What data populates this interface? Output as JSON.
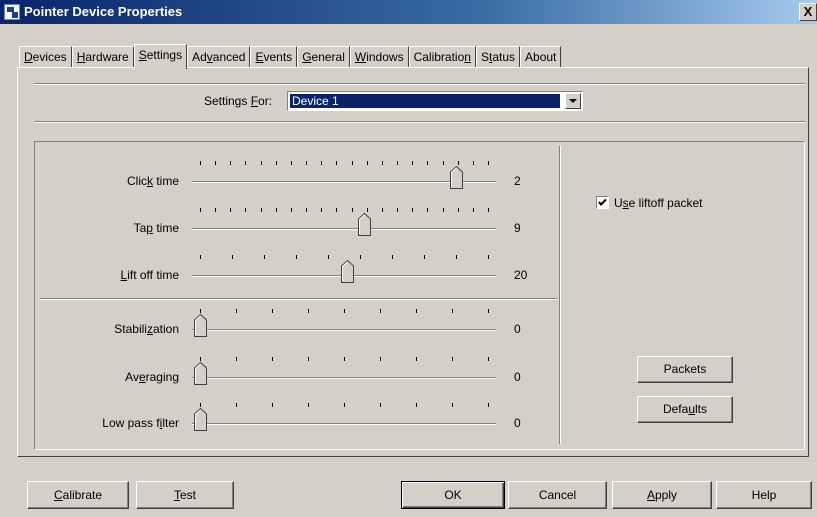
{
  "window": {
    "title": "Pointer Device Properties",
    "close_label": "X"
  },
  "tabs": [
    {
      "pre": "",
      "acc": "D",
      "post": "evices",
      "active": false
    },
    {
      "pre": "",
      "acc": "H",
      "post": "ardware",
      "active": false
    },
    {
      "pre": "",
      "acc": "S",
      "post": "ettings",
      "active": true
    },
    {
      "pre": "Ad",
      "acc": "v",
      "post": "anced",
      "active": false
    },
    {
      "pre": "",
      "acc": "E",
      "post": "vents",
      "active": false
    },
    {
      "pre": "",
      "acc": "G",
      "post": "eneral",
      "active": false
    },
    {
      "pre": "",
      "acc": "W",
      "post": "indows",
      "active": false
    },
    {
      "pre": "Calibratio",
      "acc": "n",
      "post": "",
      "active": false
    },
    {
      "pre": "S",
      "acc": "t",
      "post": "atus",
      "active": false
    },
    {
      "pre": "About",
      "acc": "",
      "post": "",
      "active": false
    }
  ],
  "settings_for": {
    "label_pre": "Settings ",
    "label_acc": "F",
    "label_post": "or:",
    "value": "Device 1"
  },
  "sliders": [
    {
      "pre": "Clic",
      "acc": "k",
      "post": " time",
      "value": "2",
      "position": 0.89
    },
    {
      "pre": "Ta",
      "acc": "p",
      "post": " time",
      "value": "9",
      "position": 0.57
    },
    {
      "pre": "",
      "acc": "L",
      "post": "ift off time",
      "value": "20",
      "position": 0.51
    },
    {
      "pre": "Stabili",
      "acc": "z",
      "post": "ation",
      "value": "0",
      "position": 0
    },
    {
      "pre": "Av",
      "acc": "e",
      "post": "raging",
      "value": "0",
      "position": 0
    },
    {
      "pre": "Low pass f",
      "acc": "i",
      "post": "lter",
      "value": "0",
      "position": 0
    }
  ],
  "liftoff": {
    "pre": "U",
    "acc": "s",
    "post": "e liftoff packet",
    "checked": true
  },
  "buttons": {
    "packets": "Packets",
    "defaults": {
      "pre": "Defa",
      "acc": "u",
      "post": "lts"
    },
    "calibrate": {
      "pre": "",
      "acc": "C",
      "post": "alibrate"
    },
    "test": {
      "pre": "",
      "acc": "T",
      "post": "est"
    },
    "ok": "OK",
    "cancel": "Cancel",
    "apply": {
      "pre": "",
      "acc": "A",
      "post": "pply"
    },
    "help": "Help"
  }
}
